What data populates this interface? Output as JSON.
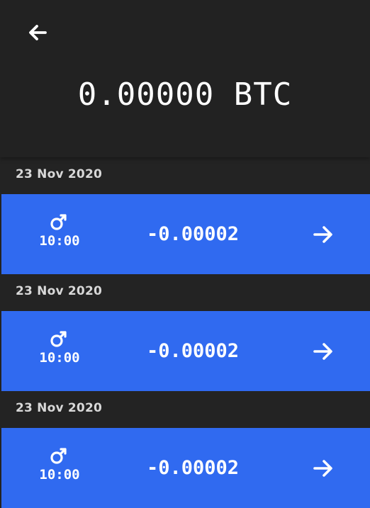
{
  "header": {
    "back_icon": "arrow-left-icon",
    "balance": "0.00000 BTC"
  },
  "transactions": [
    {
      "date": "23 Nov 2020",
      "icon": "male-symbol-icon",
      "time": "10:00",
      "amount": "-0.00002",
      "action_icon": "arrow-right-icon"
    },
    {
      "date": "23 Nov 2020",
      "icon": "male-symbol-icon",
      "time": "10:00",
      "amount": "-0.00002",
      "action_icon": "arrow-right-icon"
    },
    {
      "date": "23 Nov 2020",
      "icon": "male-symbol-icon",
      "time": "10:00",
      "amount": "-0.00002",
      "action_icon": "arrow-right-icon"
    }
  ],
  "colors": {
    "background": "#232323",
    "header": "#222222",
    "card": "#306af0",
    "text": "#ffffff",
    "date_text": "#d8d8d8"
  }
}
